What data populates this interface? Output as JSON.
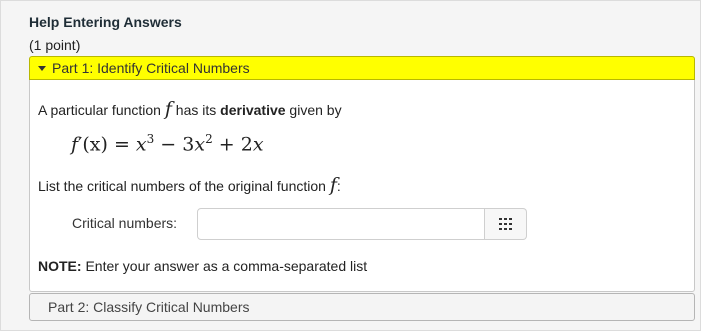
{
  "header": {
    "help_link": "Help Entering Answers",
    "points": "(1 point)"
  },
  "part1": {
    "title": "Part 1: Identify Critical Numbers",
    "line1_prefix": "A particular function ",
    "line1_symbol": "f",
    "line1_middle": " has its ",
    "line1_bold": "derivative",
    "line1_suffix": " given by",
    "equation": {
      "lhs_f": "f",
      "lhs_rest": "′(x) = ",
      "t1": "x",
      "e1": "3",
      "op1": " − 3",
      "t2": "x",
      "e2": "2",
      "op2": " + 2",
      "t3": "x"
    },
    "line2_prefix": "List the critical numbers of the original function ",
    "line2_symbol": "f",
    "line2_suffix": ":",
    "critical_label": "Critical numbers:",
    "critical_value": "",
    "note_bold": "NOTE:",
    "note_text": " Enter your answer as a comma-separated list"
  },
  "part2": {
    "title": "Part 2: Classify Critical Numbers"
  },
  "icons": {
    "palette": "grid-keypad-icon",
    "expand": "caret-down-icon"
  }
}
